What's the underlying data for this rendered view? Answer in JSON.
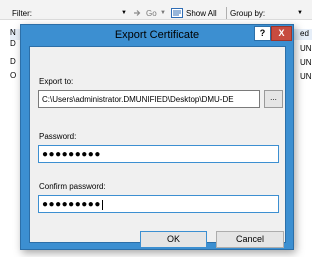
{
  "background": {
    "filter_label": "Filter:",
    "go_label": "Go",
    "show_all_label": "Show All",
    "group_by_label": "Group by:",
    "left_col_fragments": [
      "N",
      "D",
      "D",
      "O"
    ],
    "right_col_fragments": [
      "ed",
      "UN",
      "UN",
      "UN"
    ]
  },
  "dialog": {
    "title": "Export Certificate",
    "help_label": "?",
    "close_label": "X",
    "export_to_label": "Export to:",
    "export_path": "C:\\Users\\administrator.DMUNIFIED\\Desktop\\DMU-DE",
    "browse_label": "...",
    "password_label": "Password:",
    "password_mask": "●●●●●●●●●",
    "confirm_label": "Confirm password:",
    "confirm_mask": "●●●●●●●●●",
    "ok_label": "OK",
    "cancel_label": "Cancel"
  }
}
